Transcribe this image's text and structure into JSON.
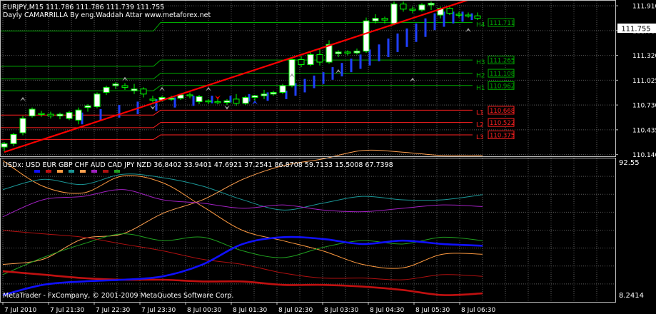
{
  "header": {
    "symbol_line": "EURJPY,M15  111.786 111.786 111.739 111.755",
    "indicator_title": "Dayly CAMARRILLA By eng.Waddah Attar  www.metaforex.net",
    "current_price": "111.755"
  },
  "sub_window": {
    "title": "USDx: USD EUR GBP CHF AUD CAD JPY NZD 36.8402 33.9401 47.6921 37.2541 86.8708 59.7133 15.5008 67.7398",
    "scale_top": "92.55",
    "scale_bottom": "8.2414"
  },
  "footer": {
    "copyright": "MetaTrader - FxCompany, © 2001-2009 MetaQuotes Software Corp."
  },
  "colors": {
    "background": "#000000",
    "grid": "#5a5a5a",
    "frame": "#c0c0c0",
    "bull_body": "#ffffff",
    "bear_body": "#000000",
    "candle_outline": "#00ff00",
    "trendline": "#ff0000",
    "level_up": "#00aa00",
    "level_down": "#ff2020",
    "signal_bar": "#2040ff",
    "text": "#ffffff"
  },
  "chart_data": [
    {
      "type": "candlestick",
      "instrument": "EURJPY",
      "timeframe": "M15",
      "y_ticks": [
        "111.910",
        "111.615",
        "111.320",
        "111.025",
        "110.730",
        "110.435",
        "110.140"
      ],
      "ylim": [
        110.12,
        111.97
      ],
      "x_ticks": [
        "7 Jul 2010",
        "7 Jul 21:30",
        "7 Jul 22:30",
        "7 Jul 23:30",
        "8 Jul 00:30",
        "8 Jul 01:30",
        "8 Jul 02:30",
        "8 Jul 03:30",
        "8 Jul 04:30",
        "8 Jul 05:30",
        "8 Jul 06:30"
      ],
      "candles": [
        {
          "o": 110.23,
          "h": 110.29,
          "l": 110.18,
          "c": 110.27
        },
        {
          "o": 110.27,
          "h": 110.4,
          "l": 110.24,
          "c": 110.38
        },
        {
          "o": 110.4,
          "h": 110.6,
          "l": 110.37,
          "c": 110.57
        },
        {
          "o": 110.6,
          "h": 110.7,
          "l": 110.58,
          "c": 110.68
        },
        {
          "o": 110.63,
          "h": 110.66,
          "l": 110.59,
          "c": 110.62
        },
        {
          "o": 110.62,
          "h": 110.65,
          "l": 110.57,
          "c": 110.6
        },
        {
          "o": 110.6,
          "h": 110.64,
          "l": 110.56,
          "c": 110.62
        },
        {
          "o": 110.57,
          "h": 110.66,
          "l": 110.55,
          "c": 110.64
        },
        {
          "o": 110.55,
          "h": 110.7,
          "l": 110.5,
          "c": 110.67
        },
        {
          "o": 110.7,
          "h": 110.74,
          "l": 110.65,
          "c": 110.72
        },
        {
          "o": 110.71,
          "h": 110.88,
          "l": 110.69,
          "c": 110.86
        },
        {
          "o": 110.88,
          "h": 110.96,
          "l": 110.85,
          "c": 110.94
        },
        {
          "o": 110.96,
          "h": 111.0,
          "l": 110.92,
          "c": 110.98
        },
        {
          "o": 110.96,
          "h": 110.99,
          "l": 110.91,
          "c": 110.94
        },
        {
          "o": 110.9,
          "h": 110.98,
          "l": 110.86,
          "c": 110.92
        },
        {
          "o": 110.92,
          "h": 110.94,
          "l": 110.82,
          "c": 110.86
        },
        {
          "o": 110.8,
          "h": 110.84,
          "l": 110.76,
          "c": 110.79
        },
        {
          "o": 110.79,
          "h": 110.84,
          "l": 110.77,
          "c": 110.82
        },
        {
          "o": 110.8,
          "h": 110.84,
          "l": 110.78,
          "c": 110.81
        },
        {
          "o": 110.81,
          "h": 110.86,
          "l": 110.79,
          "c": 110.85
        },
        {
          "o": 110.85,
          "h": 110.88,
          "l": 110.81,
          "c": 110.84
        },
        {
          "o": 110.77,
          "h": 110.85,
          "l": 110.74,
          "c": 110.83
        },
        {
          "o": 110.78,
          "h": 110.8,
          "l": 110.74,
          "c": 110.77
        },
        {
          "o": 110.77,
          "h": 110.8,
          "l": 110.74,
          "c": 110.76
        },
        {
          "o": 110.76,
          "h": 110.8,
          "l": 110.73,
          "c": 110.78
        },
        {
          "o": 110.8,
          "h": 110.86,
          "l": 110.72,
          "c": 110.75
        },
        {
          "o": 110.75,
          "h": 110.84,
          "l": 110.73,
          "c": 110.82
        },
        {
          "o": 110.82,
          "h": 110.85,
          "l": 110.78,
          "c": 110.84
        },
        {
          "o": 110.84,
          "h": 110.91,
          "l": 110.8,
          "c": 110.86
        },
        {
          "o": 110.86,
          "h": 110.9,
          "l": 110.84,
          "c": 110.88
        },
        {
          "o": 110.88,
          "h": 110.98,
          "l": 110.86,
          "c": 110.96
        },
        {
          "o": 110.96,
          "h": 111.3,
          "l": 110.94,
          "c": 111.27
        },
        {
          "o": 111.27,
          "h": 111.31,
          "l": 111.18,
          "c": 111.21
        },
        {
          "o": 111.21,
          "h": 111.36,
          "l": 111.19,
          "c": 111.33
        },
        {
          "o": 111.33,
          "h": 111.4,
          "l": 111.2,
          "c": 111.24
        },
        {
          "o": 111.24,
          "h": 111.5,
          "l": 111.22,
          "c": 111.45
        },
        {
          "o": 111.34,
          "h": 111.38,
          "l": 111.3,
          "c": 111.36
        },
        {
          "o": 111.36,
          "h": 111.38,
          "l": 111.32,
          "c": 111.35
        },
        {
          "o": 111.35,
          "h": 111.4,
          "l": 111.33,
          "c": 111.37
        },
        {
          "o": 111.37,
          "h": 111.77,
          "l": 111.35,
          "c": 111.73
        },
        {
          "o": 111.73,
          "h": 111.81,
          "l": 111.7,
          "c": 111.76
        },
        {
          "o": 111.76,
          "h": 111.78,
          "l": 111.7,
          "c": 111.74
        },
        {
          "o": 111.7,
          "h": 111.96,
          "l": 111.68,
          "c": 111.93
        },
        {
          "o": 111.93,
          "h": 111.96,
          "l": 111.84,
          "c": 111.87
        },
        {
          "o": 111.87,
          "h": 111.9,
          "l": 111.82,
          "c": 111.86
        },
        {
          "o": 111.86,
          "h": 111.94,
          "l": 111.84,
          "c": 111.92
        },
        {
          "o": 111.92,
          "h": 111.96,
          "l": 111.86,
          "c": 111.94
        },
        {
          "o": 111.8,
          "h": 111.9,
          "l": 111.76,
          "c": 111.88
        },
        {
          "o": 111.88,
          "h": 111.9,
          "l": 111.8,
          "c": 111.82
        },
        {
          "o": 111.81,
          "h": 111.84,
          "l": 111.77,
          "c": 111.8
        },
        {
          "o": 111.8,
          "h": 111.83,
          "l": 111.77,
          "c": 111.79
        },
        {
          "o": 111.79,
          "h": 111.83,
          "l": 111.74,
          "c": 111.76
        }
      ],
      "levels": [
        {
          "name": "H4",
          "label": "111.711",
          "value": 111.711,
          "kind": "up",
          "show_value": true
        },
        {
          "name": "H3",
          "label": "111.265",
          "value": 111.265,
          "kind": "up",
          "show_value": true
        },
        {
          "name": "H2",
          "label": "111.108",
          "value": 111.108,
          "kind": "up",
          "show_value": true
        },
        {
          "name": "H1",
          "label": "110.962",
          "value": 110.962,
          "kind": "up",
          "show_value": true
        },
        {
          "name": "L1",
          "label": "110.668",
          "value": 110.668,
          "kind": "down",
          "show_value": true
        },
        {
          "name": "L2",
          "label": "110.522",
          "value": 110.522,
          "kind": "down",
          "show_value": true
        },
        {
          "name": "L3",
          "label": "110.375",
          "value": 110.375,
          "kind": "down",
          "show_value": true
        }
      ],
      "previous_day_levels": {
        "H4": 111.61,
        "H3": 111.19,
        "H2": 111.04,
        "H1": 110.9,
        "L1": 110.61,
        "L2": 110.46,
        "L3": 110.32
      },
      "trendline": {
        "from_candle": 0,
        "from_value": 110.17,
        "to_candle": 50,
        "to_value": 111.98
      },
      "signal_bars": [
        {
          "i": 8,
          "from": 110.5,
          "to": 110.64
        },
        {
          "i": 10,
          "from": 110.54,
          "to": 110.68
        },
        {
          "i": 12,
          "from": 110.58,
          "to": 110.73
        },
        {
          "i": 14,
          "from": 110.62,
          "to": 110.77
        },
        {
          "i": 16,
          "from": 110.66,
          "to": 110.8
        },
        {
          "i": 18,
          "from": 110.7,
          "to": 110.82
        },
        {
          "i": 20,
          "from": 110.72,
          "to": 110.84
        },
        {
          "i": 22,
          "from": 110.75,
          "to": 110.84
        },
        {
          "i": 24,
          "from": 110.76,
          "to": 110.84
        },
        {
          "i": 26,
          "from": 110.77,
          "to": 110.86
        },
        {
          "i": 28,
          "from": 110.78,
          "to": 110.88
        },
        {
          "i": 30,
          "from": 110.8,
          "to": 110.9
        },
        {
          "i": 31,
          "from": 110.84,
          "to": 110.99
        },
        {
          "i": 32,
          "from": 110.88,
          "to": 111.04
        },
        {
          "i": 33,
          "from": 110.93,
          "to": 111.08
        },
        {
          "i": 34,
          "from": 110.98,
          "to": 111.12
        },
        {
          "i": 35,
          "from": 111.03,
          "to": 111.18
        },
        {
          "i": 36,
          "from": 111.07,
          "to": 111.23
        },
        {
          "i": 37,
          "from": 111.12,
          "to": 111.28
        },
        {
          "i": 38,
          "from": 111.16,
          "to": 111.33
        },
        {
          "i": 39,
          "from": 111.2,
          "to": 111.39
        },
        {
          "i": 40,
          "from": 111.25,
          "to": 111.45
        },
        {
          "i": 41,
          "from": 111.3,
          "to": 111.52
        },
        {
          "i": 42,
          "from": 111.36,
          "to": 111.58
        },
        {
          "i": 43,
          "from": 111.42,
          "to": 111.64
        },
        {
          "i": 44,
          "from": 111.48,
          "to": 111.7
        },
        {
          "i": 45,
          "from": 111.54,
          "to": 111.76
        },
        {
          "i": 46,
          "from": 111.62,
          "to": 111.82
        },
        {
          "i": 47,
          "from": 111.66,
          "to": 111.84
        },
        {
          "i": 48,
          "from": 111.7,
          "to": 111.84
        },
        {
          "i": 49,
          "from": 111.72,
          "to": 111.84
        },
        {
          "i": 50,
          "from": 111.74,
          "to": 111.82
        }
      ],
      "arrows": [
        {
          "i": 2,
          "value": 110.8,
          "dir": "up",
          "color": "#a0a0a0"
        },
        {
          "i": 13,
          "value": 111.04,
          "dir": "up",
          "color": "#a0a0a0"
        },
        {
          "i": 16,
          "value": 110.7,
          "dir": "down",
          "color": "#a0a0a0"
        },
        {
          "i": 17,
          "value": 110.92,
          "dir": "up",
          "color": "#a0a0a0"
        },
        {
          "i": 22,
          "value": 110.92,
          "dir": "up",
          "color": "#a0a0a0"
        },
        {
          "i": 24,
          "value": 110.7,
          "dir": "down",
          "color": "#a0a0a0"
        },
        {
          "i": 23,
          "value": 110.82,
          "dir": "down",
          "color": "#ff0000"
        },
        {
          "i": 27,
          "value": 110.76,
          "dir": "up",
          "color": "#2040ff"
        },
        {
          "i": 31,
          "value": 111.08,
          "dir": "up",
          "color": "#a0a0a0"
        },
        {
          "i": 36,
          "value": 111.13,
          "dir": "up",
          "color": "#a0a0a0"
        },
        {
          "i": 44,
          "value": 111.03,
          "dir": "up",
          "color": "#a0a0a0"
        },
        {
          "i": 42,
          "value": 112.0,
          "dir": "up",
          "color": "#a0a0a0"
        },
        {
          "i": 47,
          "value": 112.0,
          "dir": "up",
          "color": "#a0a0a0"
        },
        {
          "i": 50,
          "value": 111.62,
          "dir": "up",
          "color": "#a0a0a0"
        }
      ]
    },
    {
      "type": "line",
      "title": "USDx",
      "ylim": [
        8.2414,
        92.55
      ],
      "x_count": 13,
      "series": [
        {
          "name": "USD",
          "color": "#1010ff",
          "width": 2.6,
          "values": [
            4,
            10,
            12,
            13,
            15,
            22,
            34,
            38,
            37,
            34,
            36,
            34,
            33
          ]
        },
        {
          "name": "EUR",
          "color": "#c01010",
          "width": 2.6,
          "values": [
            18,
            16,
            14,
            13,
            13,
            12,
            12,
            10,
            10,
            9,
            7,
            4,
            5
          ]
        },
        {
          "name": "GBP",
          "color": "#ff9a40",
          "width": 1,
          "values": [
            83,
            68,
            64,
            74,
            70,
            56,
            42,
            36,
            30,
            22,
            20,
            28,
            28
          ]
        },
        {
          "name": "CHF",
          "color": "#1b9696",
          "width": 1,
          "values": [
            66,
            72,
            69,
            75,
            73,
            68,
            60,
            54,
            58,
            62,
            60,
            60,
            63
          ]
        },
        {
          "name": "AUD",
          "color": "#ffa050",
          "width": 1,
          "values": [
            22,
            25,
            37,
            40,
            52,
            60,
            72,
            80,
            84,
            89,
            88,
            86,
            86
          ]
        },
        {
          "name": "CAD",
          "color": "#a020c0",
          "width": 1,
          "values": [
            50,
            60,
            62,
            66,
            60,
            58,
            55,
            57,
            54,
            53,
            55,
            57,
            56
          ]
        },
        {
          "name": "JPY",
          "color": "#b01010",
          "width": 1,
          "values": [
            42,
            40,
            38,
            34,
            30,
            25,
            22,
            17,
            14,
            14,
            13,
            16,
            15
          ]
        },
        {
          "name": "NZD",
          "color": "#20a020",
          "width": 1,
          "values": [
            16,
            26,
            34,
            40,
            36,
            38,
            30,
            26,
            32,
            36,
            34,
            38,
            36
          ]
        }
      ]
    }
  ]
}
